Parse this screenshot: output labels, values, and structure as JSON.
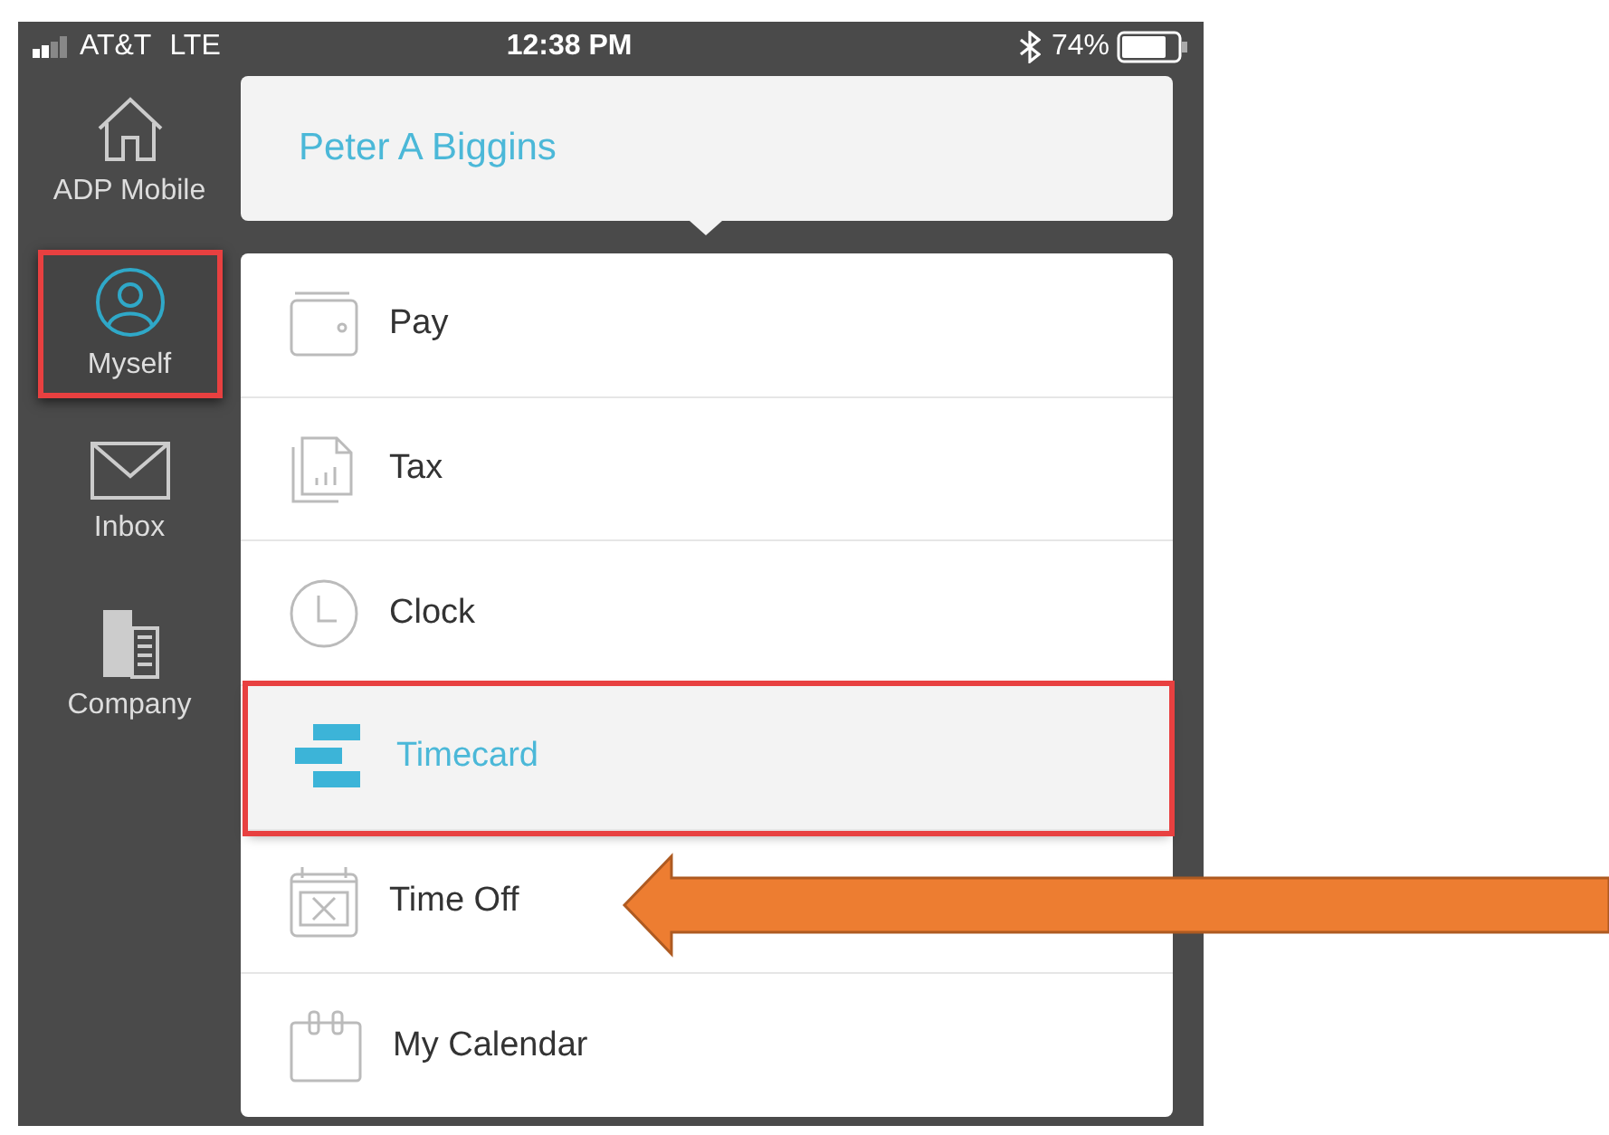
{
  "status_bar": {
    "carrier": "AT&T",
    "network": "LTE",
    "time": "12:38 PM",
    "battery": "74%"
  },
  "sidebar": {
    "items": [
      {
        "label": "ADP Mobile",
        "selected": false
      },
      {
        "label": "Myself",
        "selected": true
      },
      {
        "label": "Inbox",
        "selected": false
      },
      {
        "label": "Company",
        "selected": false
      }
    ]
  },
  "header": {
    "name": "Peter A Biggins"
  },
  "menu": {
    "items": [
      {
        "label": "Pay",
        "selected": false
      },
      {
        "label": "Tax",
        "selected": false
      },
      {
        "label": "Clock",
        "selected": false
      },
      {
        "label": "Timecard",
        "selected": true
      },
      {
        "label": "Time Off",
        "selected": false
      },
      {
        "label": "My Calendar",
        "selected": false
      }
    ]
  }
}
